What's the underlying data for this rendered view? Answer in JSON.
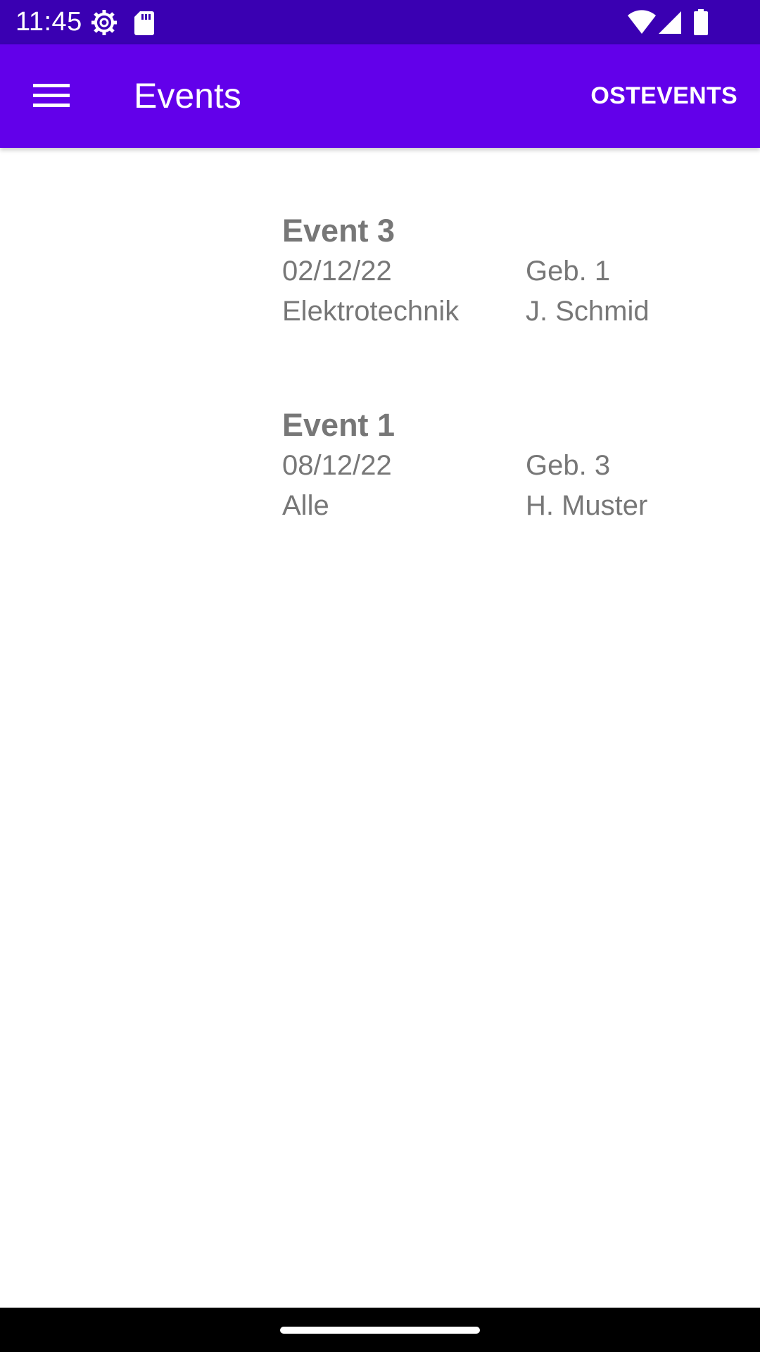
{
  "status_bar": {
    "time": "11:45",
    "icons": [
      "settings-gear-icon",
      "sd-card-icon",
      "wifi-icon",
      "signal-icon",
      "battery-icon"
    ],
    "background_color": "#3a00b2"
  },
  "app_bar": {
    "menu_icon": "hamburger-menu-icon",
    "title": "Events",
    "action_label": "OSTEVENTS",
    "background_color": "#6200ea"
  },
  "events": [
    {
      "title": "Event 3",
      "date": "02/12/22",
      "building": "Geb. 1",
      "department": "Elektrotechnik",
      "contact": "J. Schmid"
    },
    {
      "title": "Event 1",
      "date": "08/12/22",
      "building": "Geb. 3",
      "department": "Alle",
      "contact": "H. Muster"
    }
  ],
  "colors": {
    "event_text": "#777777",
    "nav_bar": "#000000"
  }
}
